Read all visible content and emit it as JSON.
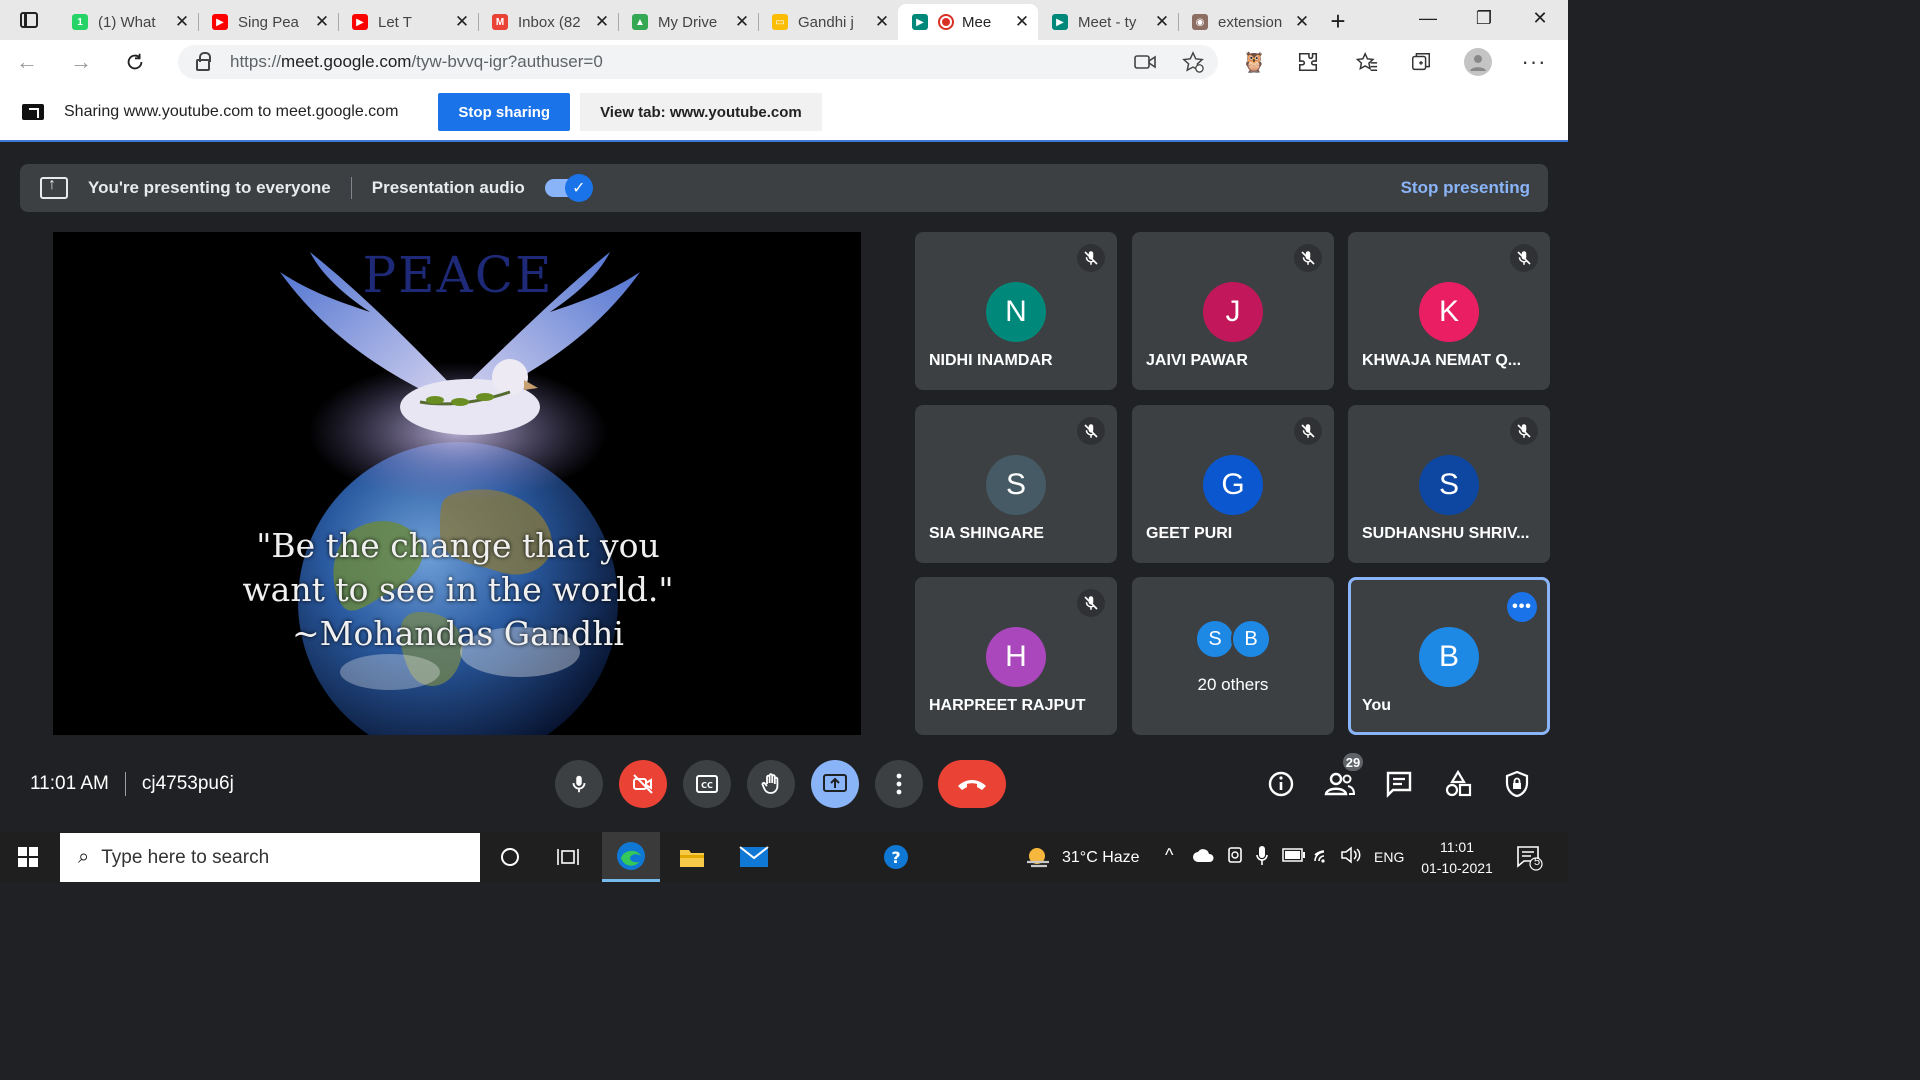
{
  "browser": {
    "tabs": [
      {
        "label": "(1) What",
        "fav": "whatsapp",
        "color": "#25d366",
        "glyph": "1"
      },
      {
        "label": "Sing Pea",
        "fav": "youtube",
        "color": "#ff0000",
        "glyph": "▶"
      },
      {
        "label": "Let T",
        "fav": "youtube-and-screen",
        "color": "#ff0000",
        "glyph": "▶"
      },
      {
        "label": "Inbox (82",
        "fav": "gmail",
        "color": "#ea4335",
        "glyph": "M"
      },
      {
        "label": "My Drive",
        "fav": "google-drive",
        "color": "#34a853",
        "glyph": "▲"
      },
      {
        "label": "Gandhi j",
        "fav": "google-slides",
        "color": "#fbbc04",
        "glyph": "▭"
      },
      {
        "label": "Mee",
        "fav": "google-meet",
        "color": "#00897b",
        "glyph": "▶",
        "active": true
      },
      {
        "label": "Meet - ty",
        "fav": "google-meet",
        "color": "#00897b",
        "glyph": "▶"
      },
      {
        "label": "extension",
        "fav": "owl",
        "color": "#8d6e63",
        "glyph": "◉"
      }
    ],
    "url": {
      "scheme": "https://",
      "host": "meet.google.com",
      "path": "/tyw-bvvq-igr?authuser=0"
    }
  },
  "share_bar": {
    "text": "Sharing www.youtube.com to meet.google.com",
    "stop_label": "Stop sharing",
    "view_tab_label": "View tab: www.youtube.com"
  },
  "present_banner": {
    "title": "You're presenting to everyone",
    "audio_label": "Presentation audio",
    "audio_on": true,
    "stop_label": "Stop presenting"
  },
  "slide": {
    "heading": "PEACE",
    "quote_lines": [
      "\"Be the change that you",
      "want to see in the world.\"",
      "~Mohandas Gandhi"
    ]
  },
  "participants": [
    {
      "initial": "N",
      "name": "NIDHI INAMDAR",
      "color": "#00897b",
      "muted": true
    },
    {
      "initial": "J",
      "name": "JAIVI PAWAR",
      "color": "#c2185b",
      "muted": true
    },
    {
      "initial": "K",
      "name": "KHWAJA NEMAT Q...",
      "color": "#e91e63",
      "muted": true
    },
    {
      "initial": "S",
      "name": "SIA SHINGARE",
      "color": "#455a64",
      "muted": true
    },
    {
      "initial": "G",
      "name": "GEET PURI",
      "color": "#0b57d0",
      "muted": true
    },
    {
      "initial": "S",
      "name": "SUDHANSHU SHRIV...",
      "color": "#0d47a1",
      "muted": true
    },
    {
      "initial": "H",
      "name": "HARPREET RAJPUT",
      "color": "#ab47bc",
      "muted": true
    }
  ],
  "others": {
    "initials": [
      "S",
      "B"
    ],
    "colors": [
      "#1e88e5",
      "#1e88e5"
    ],
    "label": "20 others"
  },
  "self_tile": {
    "initial": "B",
    "name": "You",
    "color": "#1e88e5"
  },
  "callbar": {
    "time": "11:01 AM",
    "meeting_code": "cj4753pu6j",
    "people_count": "29"
  },
  "taskbar": {
    "search_placeholder": "Type here to search",
    "weather": "31°C  Haze",
    "language": "ENG",
    "time": "11:01",
    "date": "01-10-2021",
    "notifications": "5"
  }
}
